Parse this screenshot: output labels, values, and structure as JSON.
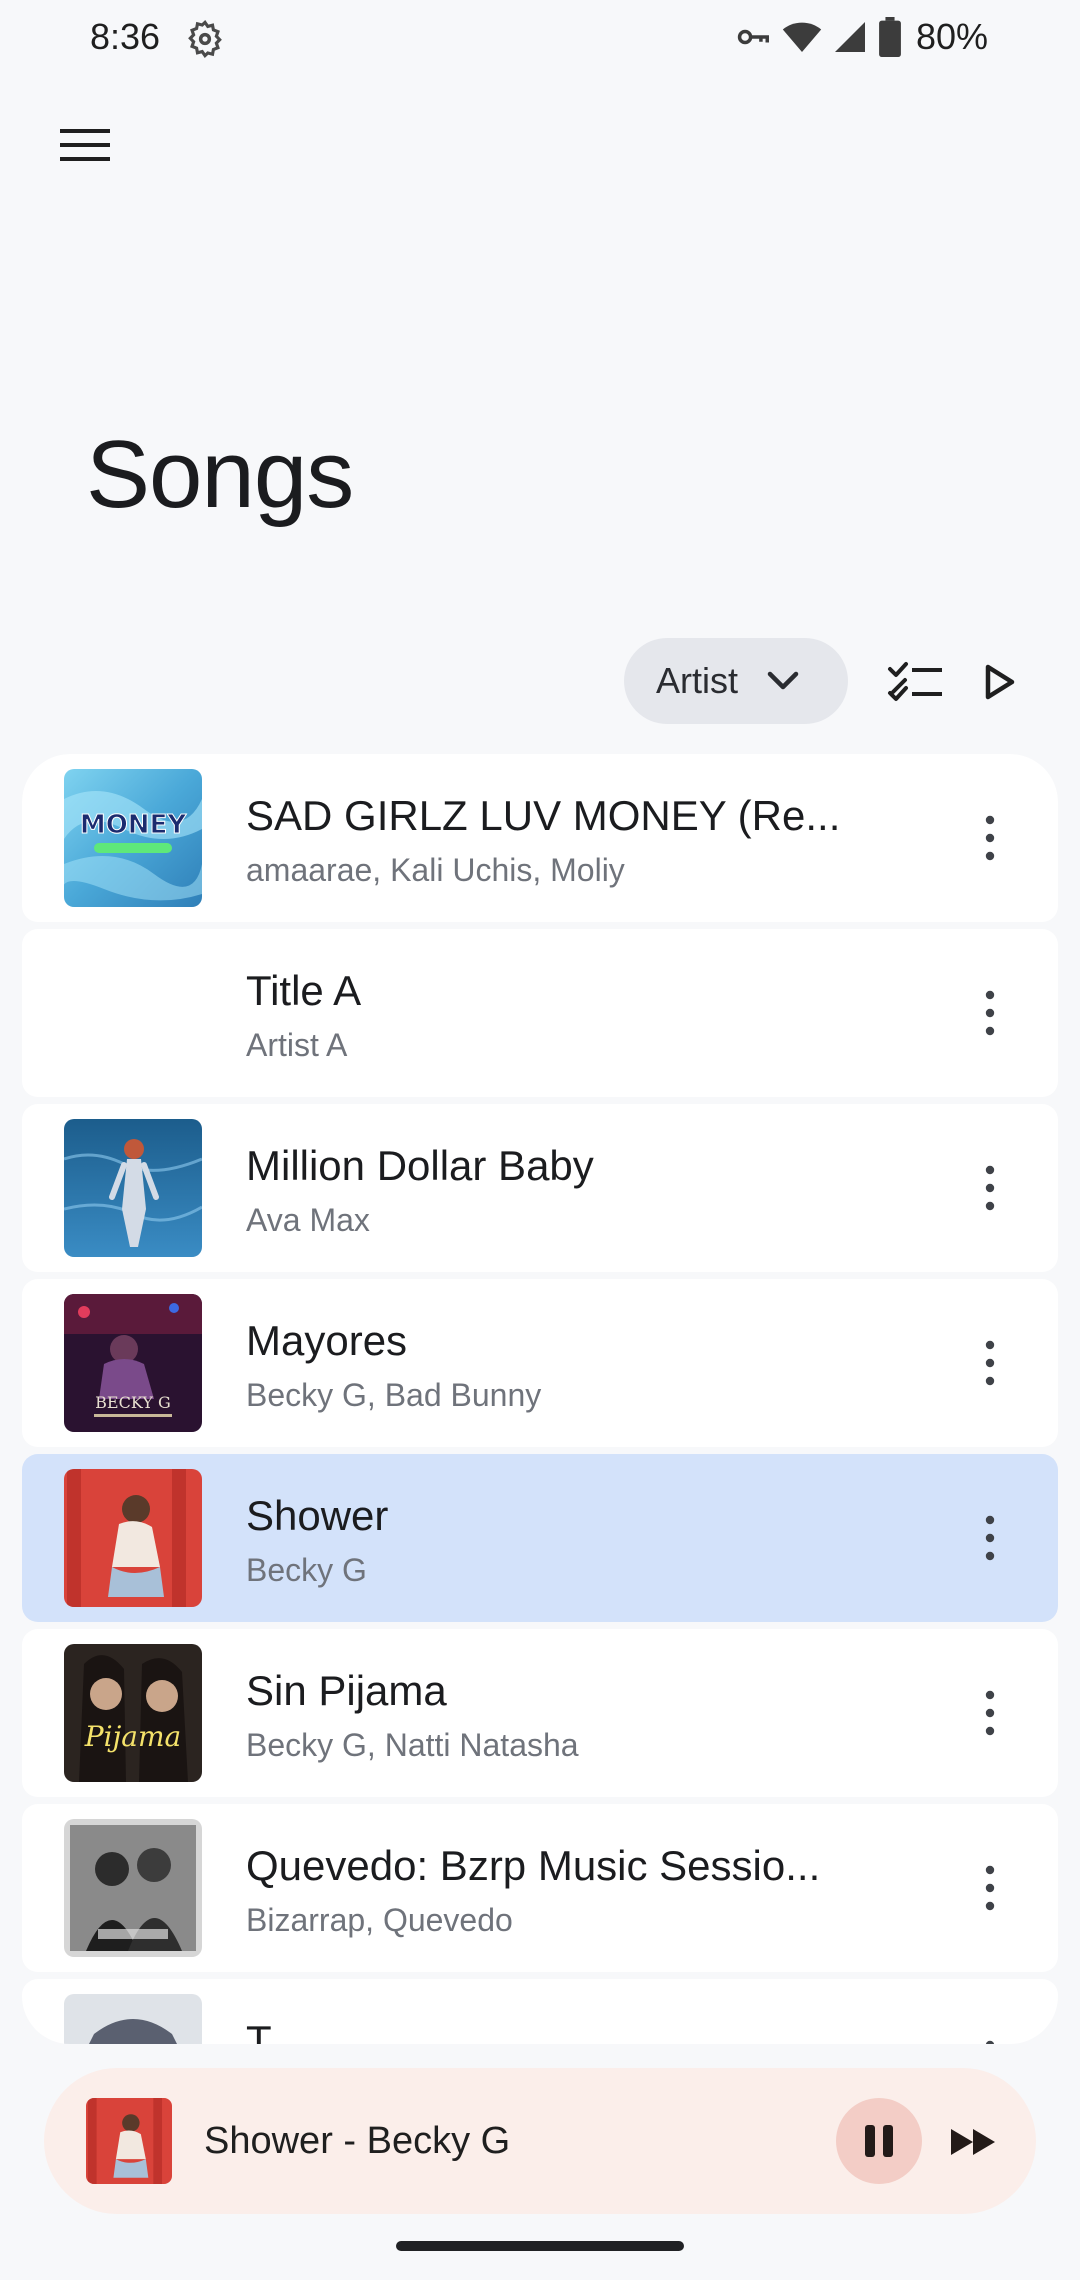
{
  "status_bar": {
    "time": "8:36",
    "battery": "80%",
    "icons": [
      "gear-icon",
      "vpn-key-icon",
      "wifi-icon",
      "signal-icon",
      "battery-icon"
    ]
  },
  "header": {
    "menu_icon": "hamburger-menu-icon",
    "title": "Songs"
  },
  "toolbar": {
    "sort_label": "Artist",
    "sort_icon": "chevron-down-icon",
    "select_icon": "checklist-icon",
    "play_icon": "play-icon"
  },
  "songs": [
    {
      "title": "SAD GIRLZ LUV MONEY (Re...",
      "artist": "amaarae, Kali Uchis, Moliy",
      "art_text": "MONEY",
      "has_art": true
    },
    {
      "title": "Title A",
      "artist": "Artist A",
      "has_art": false
    },
    {
      "title": "Million Dollar Baby",
      "artist": "Ava Max",
      "has_art": true
    },
    {
      "title": "Mayores",
      "artist": "Becky G, Bad Bunny",
      "art_text": "BECKY G",
      "has_art": true
    },
    {
      "title": "Shower",
      "artist": "Becky G",
      "has_art": true,
      "playing": true
    },
    {
      "title": "Sin Pijama",
      "artist": "Becky G, Natti Natasha",
      "art_text": "Pijama",
      "has_art": true
    },
    {
      "title": "Quevedo: Bzrp Music Sessio...",
      "artist": "Bizarrap, Quevedo",
      "has_art": true
    },
    {
      "title": "T",
      "artist": "",
      "has_art": true
    }
  ],
  "now_playing": {
    "label": "Shower - Becky G",
    "pause_icon": "pause-icon",
    "next_icon": "skip-next-icon"
  },
  "colors": {
    "background": "#f7f8fa",
    "active_row": "#d3e2fa",
    "mini_player": "#fbeeea",
    "pause_button": "#f3cdc6"
  }
}
